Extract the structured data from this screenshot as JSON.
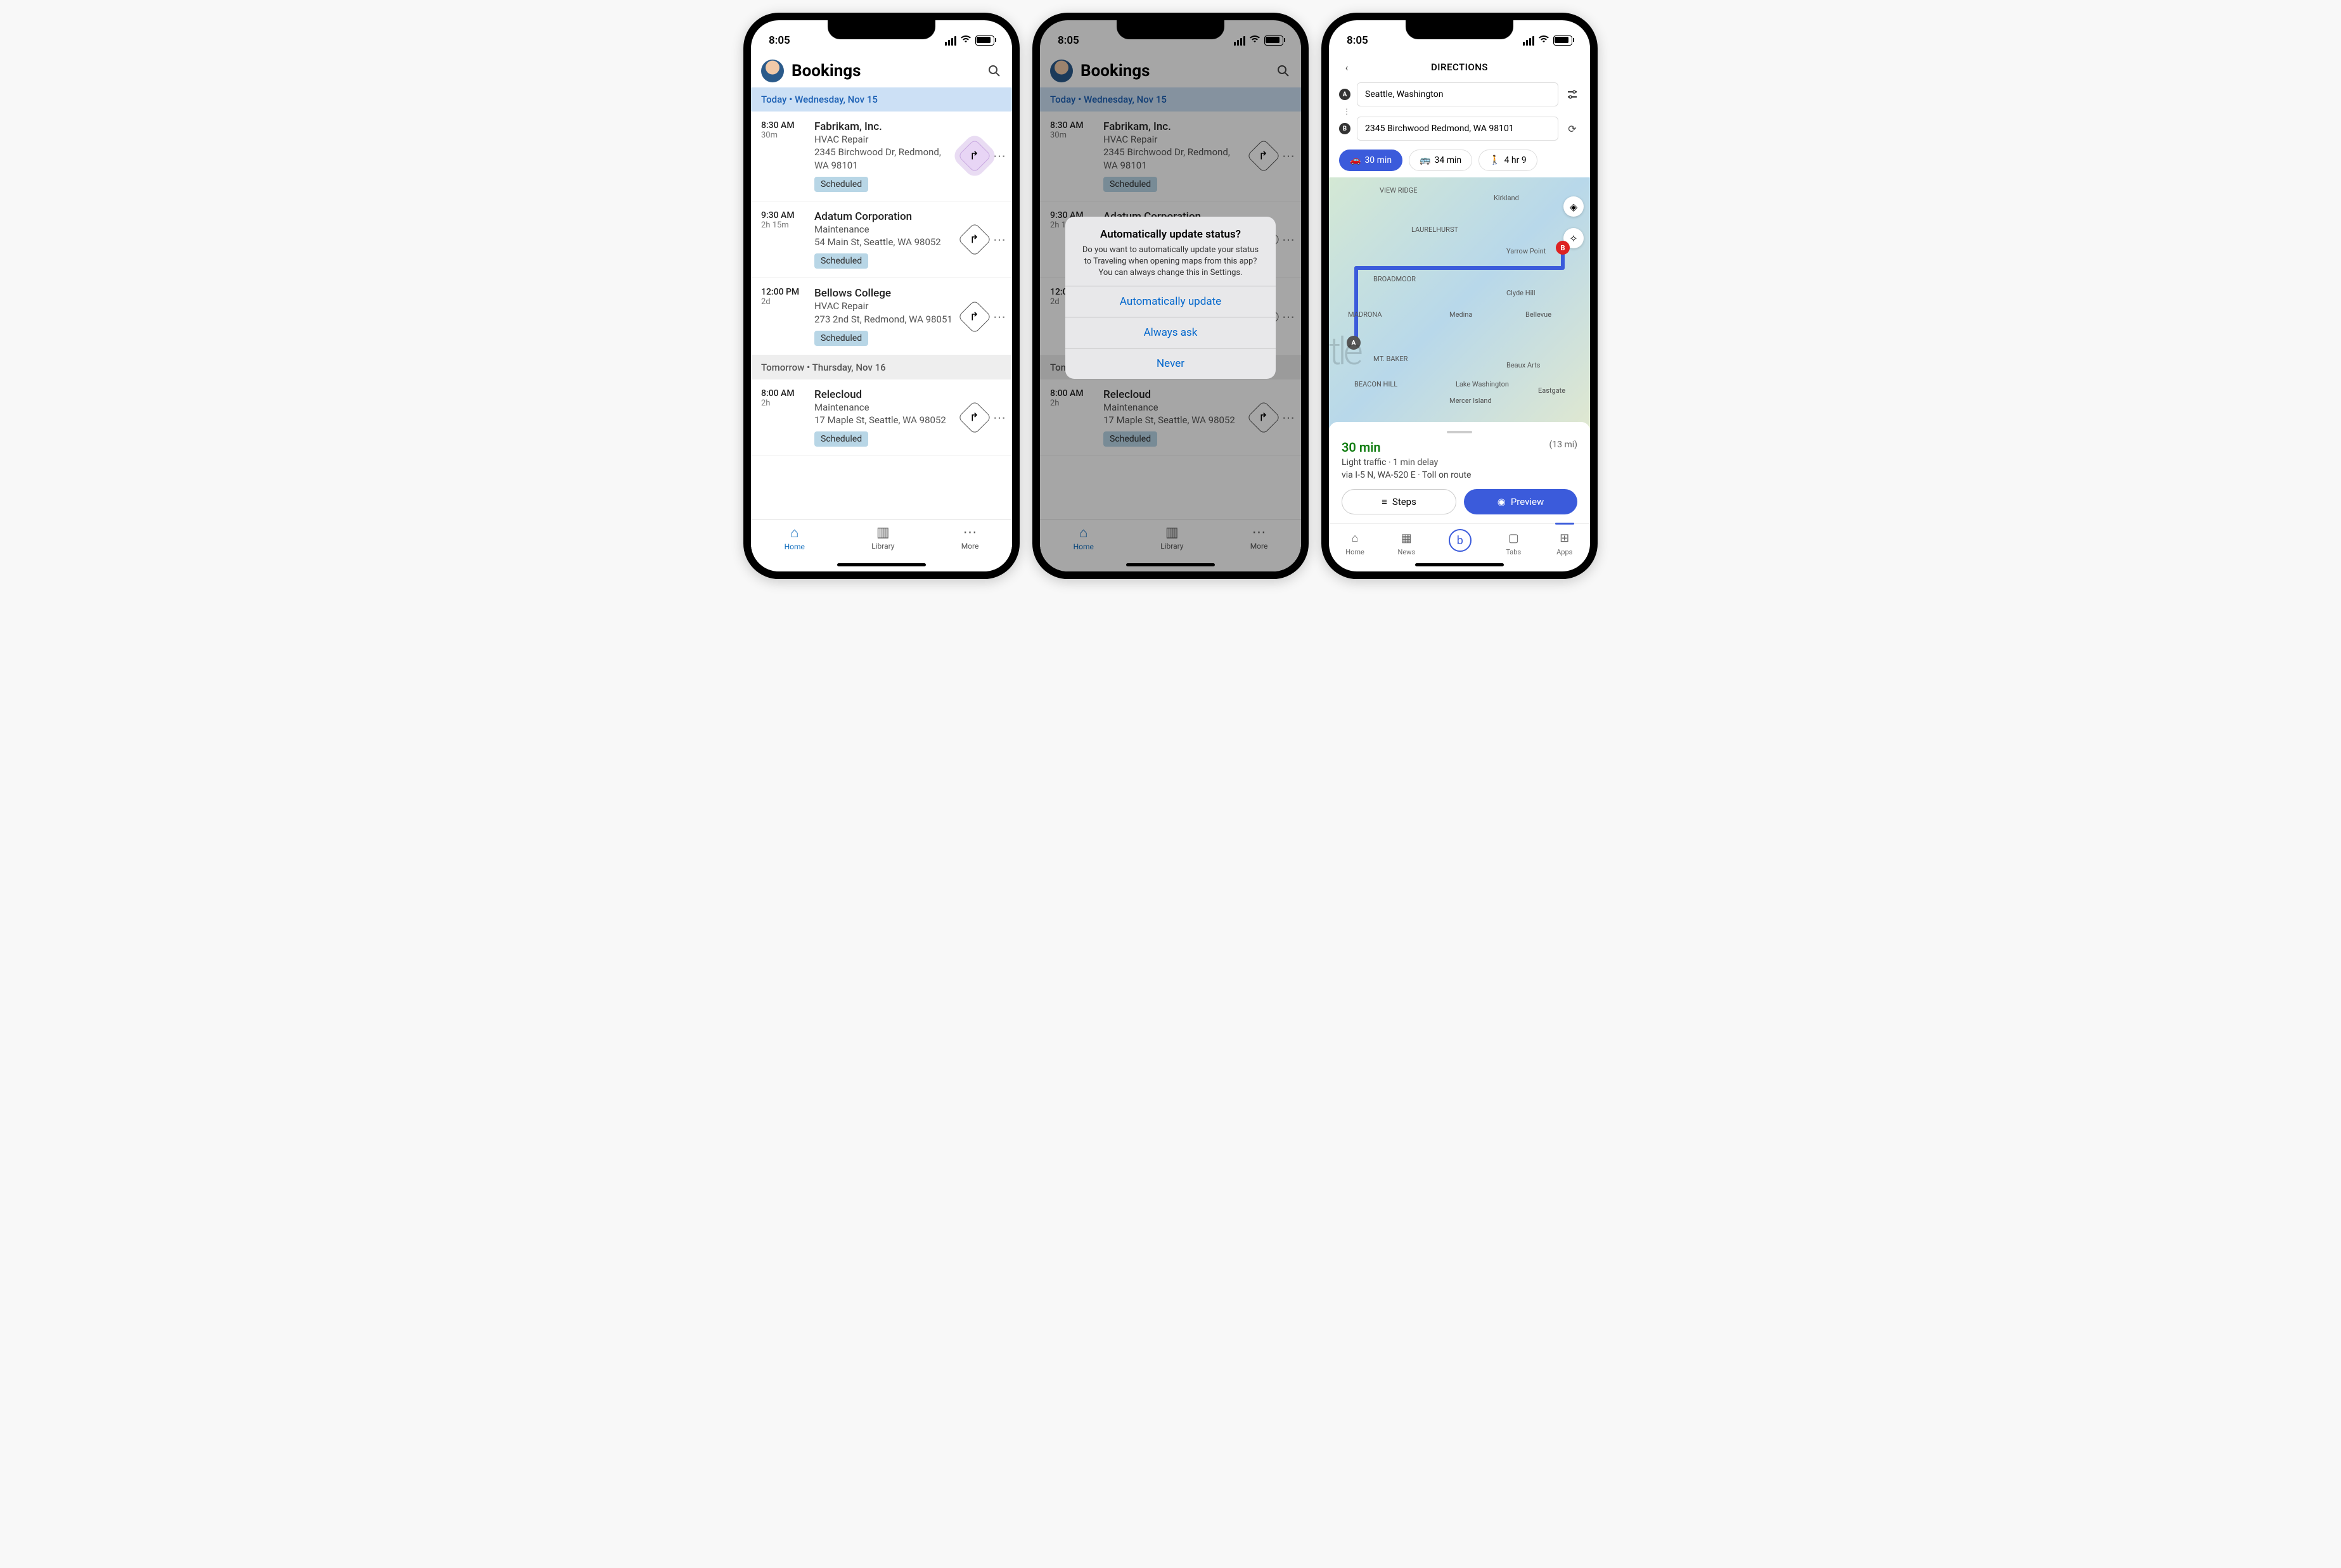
{
  "time": "8:05",
  "header": {
    "title": "Bookings"
  },
  "sections": [
    {
      "id": "today",
      "prefix": "Today",
      "date": "Wednesday, Nov 15"
    },
    {
      "id": "tomorrow",
      "prefix": "Tomorrow",
      "date": "Thursday, Nov 16"
    }
  ],
  "bookings": [
    {
      "time": "8:30 AM",
      "dur": "30m",
      "name": "Fabrikam, Inc.",
      "type": "HVAC Repair",
      "addr": "2345 Birchwood Dr, Redmond, WA 98101",
      "status": "Scheduled",
      "section": "today",
      "highlight": true
    },
    {
      "time": "9:30 AM",
      "dur": "2h 15m",
      "name": "Adatum Corporation",
      "type": "Maintenance",
      "addr": "54 Main St, Seattle, WA 98052",
      "status": "Scheduled",
      "section": "today"
    },
    {
      "time": "12:00 PM",
      "dur": "2d",
      "name": "Bellows College",
      "type": "HVAC Repair",
      "addr": "273 2nd St, Redmond, WA 98051",
      "status": "Scheduled",
      "section": "today"
    },
    {
      "time": "8:00 AM",
      "dur": "2h",
      "name": "Relecloud",
      "type": "Maintenance",
      "addr": "17 Maple St, Seattle, WA 98052",
      "status": "Scheduled",
      "section": "tomorrow"
    }
  ],
  "tabs": {
    "home": "Home",
    "library": "Library",
    "more": "More"
  },
  "alert": {
    "title": "Automatically update status?",
    "body": "Do you want to automatically update your status to Traveling when opening maps from this app? You can always change this in Settings.",
    "b1": "Automatically update",
    "b2": "Always ask",
    "b3": "Never"
  },
  "directions": {
    "title": "DIRECTIONS",
    "from": "Seattle, Washington",
    "to": "2345 Birchwood Redmond, WA 98101",
    "modes": {
      "car": "30 min",
      "transit": "34 min",
      "walk": "4 hr 9"
    },
    "map_labels": [
      "VIEW RIDGE",
      "Kirkland",
      "LAURELHURST",
      "Yarrow Point",
      "BROADMOOR",
      "Clyde Hill",
      "MADRONA",
      "Medina",
      "Bellevue",
      "MT. BAKER",
      "Beaux Arts",
      "BEACON HILL",
      "Lake Washington",
      "Mercer Island",
      "Eastgate"
    ],
    "summary": {
      "time": "30 min",
      "dist": "(13 mi)",
      "traffic": "Light traffic · 1 min delay",
      "via": "via I-5 N, WA-520 E · Toll on route"
    },
    "btns": {
      "steps": "Steps",
      "preview": "Preview"
    },
    "tabs": {
      "home": "Home",
      "news": "News",
      "tabs": "Tabs",
      "apps": "Apps"
    }
  }
}
